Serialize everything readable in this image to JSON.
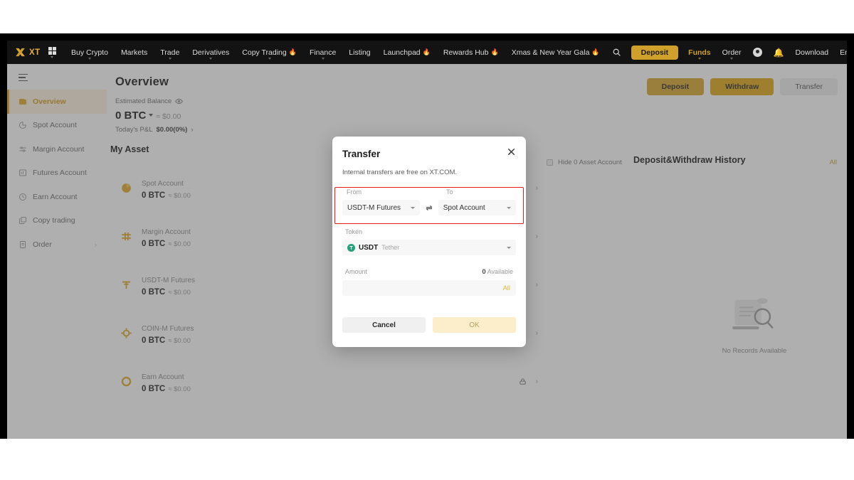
{
  "topnav": {
    "brand": "XT",
    "apps_icon": "apps-grid-icon",
    "items": [
      {
        "label": "Buy Crypto",
        "dropdown": true,
        "flame": false
      },
      {
        "label": "Markets",
        "dropdown": false,
        "flame": false
      },
      {
        "label": "Trade",
        "dropdown": true,
        "flame": false
      },
      {
        "label": "Derivatives",
        "dropdown": true,
        "flame": false
      },
      {
        "label": "Copy Trading",
        "dropdown": true,
        "flame": true
      },
      {
        "label": "Finance",
        "dropdown": true,
        "flame": false
      },
      {
        "label": "Listing",
        "dropdown": false,
        "flame": false
      },
      {
        "label": "Launchpad",
        "dropdown": false,
        "flame": true
      },
      {
        "label": "Rewards Hub",
        "dropdown": false,
        "flame": true
      },
      {
        "label": "Xmas & New Year Gala",
        "dropdown": false,
        "flame": true
      }
    ],
    "right": {
      "search_icon": "search-icon",
      "deposit": "Deposit",
      "funds": "Funds",
      "order": "Order",
      "account_icon": "user-avatar-icon",
      "notification_icon": "bell-icon",
      "download": "Download",
      "language": "English/USD",
      "theme_icon": "sun-icon"
    }
  },
  "sidebar": {
    "menu_icon": "hamburger-icon",
    "items": [
      {
        "label": "Overview",
        "icon": "wallet-icon",
        "active": true
      },
      {
        "label": "Spot Account",
        "icon": "pie-chart-icon",
        "active": false
      },
      {
        "label": "Margin Account",
        "icon": "sliders-icon",
        "active": false
      },
      {
        "label": "Futures Account",
        "icon": "chart-icon",
        "active": false
      },
      {
        "label": "Earn Account",
        "icon": "clock-icon",
        "active": false
      },
      {
        "label": "Copy trading",
        "icon": "copy-icon",
        "active": false
      },
      {
        "label": "Order",
        "icon": "list-icon",
        "active": false,
        "chevron": true
      }
    ]
  },
  "overview": {
    "title": "Overview",
    "estimated_balance_label": "Estimated Balance",
    "eye_icon": "eye-icon",
    "balance": "0 BTC",
    "balance_usd": "≈ $0.00",
    "pnl_label": "Today's P&L",
    "pnl_value": "$0.00(0%)",
    "buttons": {
      "deposit": "Deposit",
      "withdraw": "Withdraw",
      "transfer": "Transfer"
    }
  },
  "my_asset": {
    "title": "My Asset",
    "rows": [
      {
        "name": "Spot Account",
        "btc": "0 BTC",
        "usd": "≈ $0.00",
        "icon": "spot-coin-icon",
        "actions": [
          "deposit-icon",
          "withdraw-icon",
          "buy-icon",
          "transfer-icon"
        ]
      },
      {
        "name": "Margin Account",
        "btc": "0 BTC",
        "usd": "≈ $0.00",
        "icon": "margin-icon",
        "actions": [
          "borrow-icon",
          "repay-icon",
          "transfer-icon"
        ]
      },
      {
        "name": "USDT-M Futures",
        "btc": "0 BTC",
        "usd": "≈ $0.00",
        "icon": "usdtm-icon",
        "actions": [
          "coins-icon",
          "transfer-icon"
        ]
      },
      {
        "name": "COIN-M Futures",
        "btc": "0 BTC",
        "usd": "≈ $0.00",
        "icon": "coinm-icon",
        "actions": [
          "coins-icon",
          "transfer-icon"
        ]
      },
      {
        "name": "Earn Account",
        "btc": "0 BTC",
        "usd": "≈ $0.00",
        "icon": "earn-icon",
        "actions": [
          "earn-lock-icon"
        ]
      }
    ]
  },
  "right_panel": {
    "hide_zero_label": "Hide 0 Asset Account",
    "hide_zero_checked": false,
    "history_title": "Deposit&Withdraw History",
    "all_link": "All",
    "empty_text": "No Records Available",
    "empty_icon": "no-records-search-icon"
  },
  "modal": {
    "title": "Transfer",
    "close_icon": "close-icon",
    "subtitle": "Internal transfers are free on XT.COM.",
    "from_label": "From",
    "to_label": "To",
    "from_value": "USDT-M Futures",
    "to_value": "Spot Account",
    "swap_icon": "swap-arrows-icon",
    "token_label": "Token",
    "token_symbol": "USDT",
    "token_name": "Tether",
    "token_badge": "T",
    "amount_label": "Amount",
    "available_value": "0",
    "available_label": "Available",
    "amount_value": "",
    "amount_placeholder": "",
    "all_label": "All",
    "cancel_label": "Cancel",
    "ok_label": "OK",
    "highlight_color": "#e71b1b"
  }
}
